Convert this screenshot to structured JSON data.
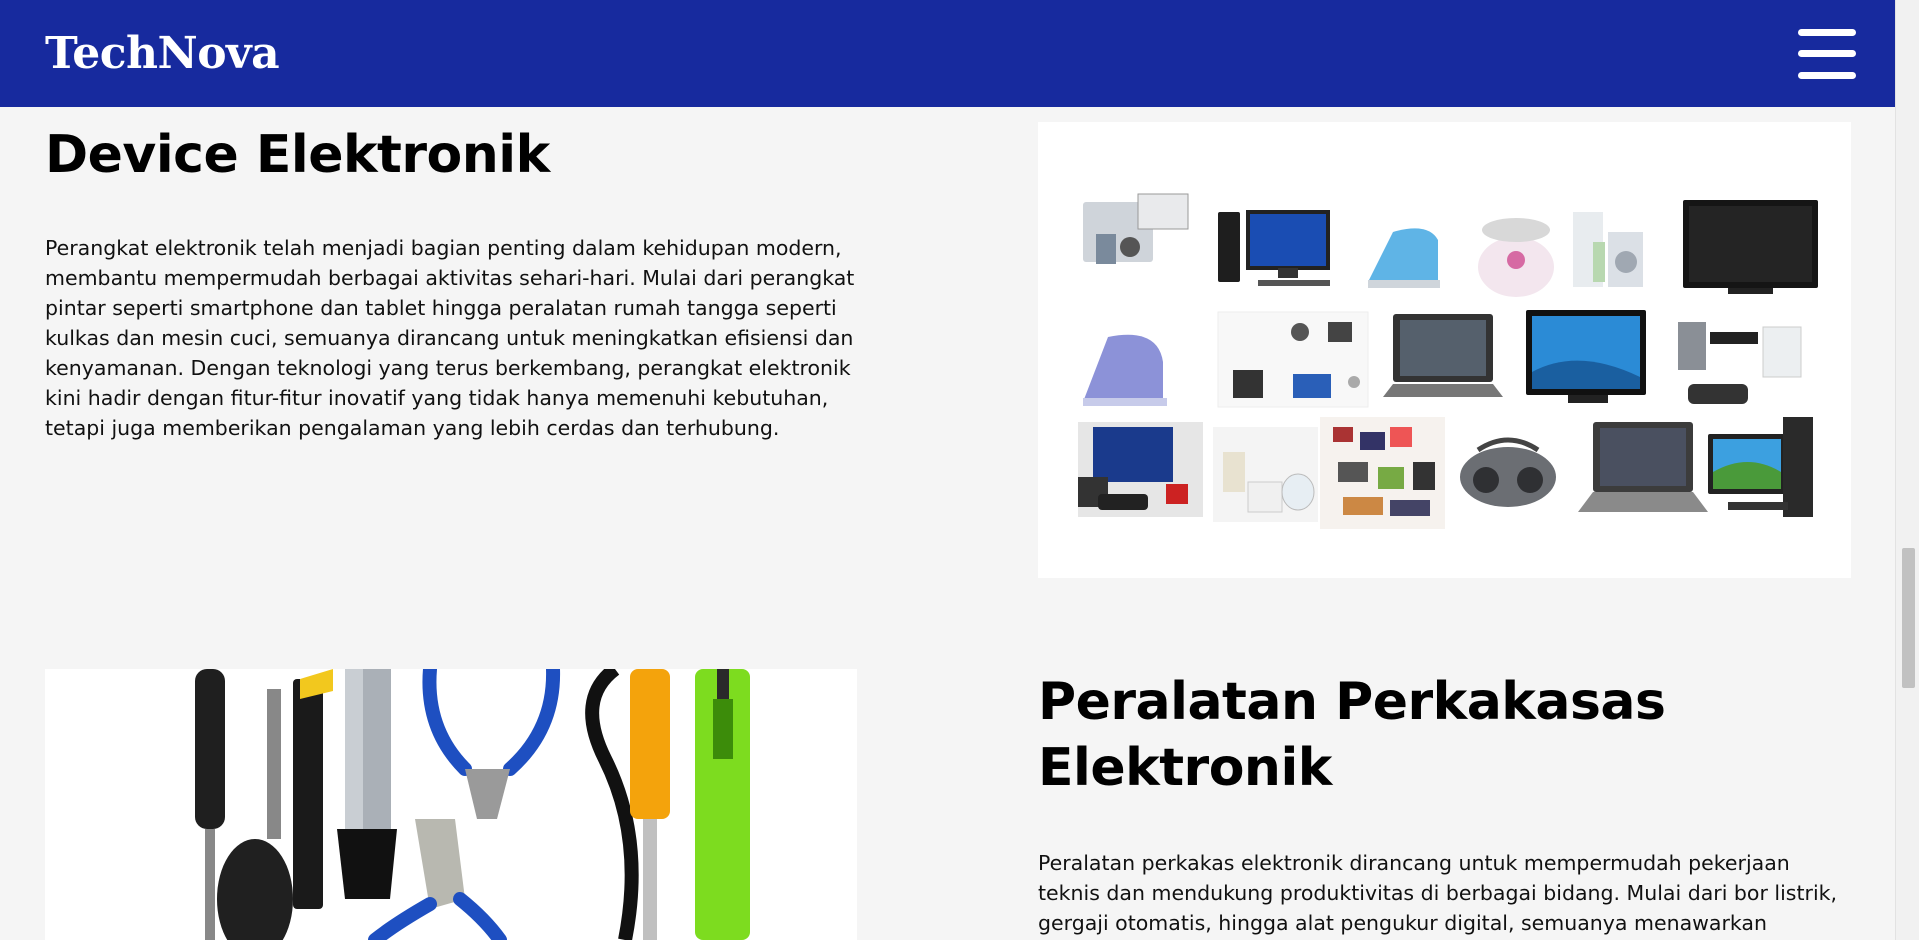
{
  "header": {
    "brand": "TechNova",
    "menu_icon": "hamburger-menu-icon"
  },
  "sections": [
    {
      "title": "Device Elektronik",
      "text": "Perangkat elektronik telah menjadi bagian penting dalam kehidupan modern, membantu mempermudah berbagai aktivitas sehari-hari. Mulai dari perangkat pintar seperti smartphone dan tablet hingga peralatan rumah tangga seperti kulkas dan mesin cuci, semuanya dirancang untuk meningkatkan efisiensi dan kenyamanan. Dengan teknologi yang terus berkembang, perangkat elektronik kini hadir dengan fitur-fitur inovatif yang tidak hanya memenuhi kebutuhan, tetapi juga memberikan pengalaman yang lebih cerdas dan terhubung.",
      "image": "electronic-devices-collage"
    },
    {
      "title": "Peralatan Perkakasas Elektronik",
      "text": "Peralatan perkakas elektronik dirancang untuk mempermudah pekerjaan teknis dan mendukung produktivitas di berbagai bidang. Mulai dari bor listrik, gergaji otomatis, hingga alat pengukur digital, semuanya menawarkan",
      "image": "electronic-tools-photo"
    }
  ],
  "colors": {
    "header_bg": "#172a9e",
    "page_bg": "#f5f5f5"
  }
}
